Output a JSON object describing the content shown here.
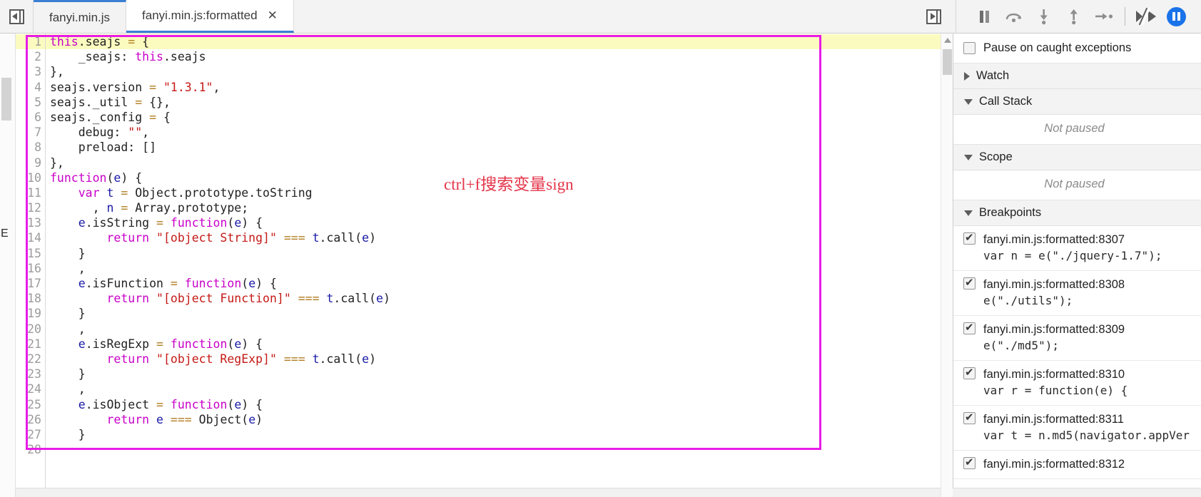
{
  "topbar": {
    "nav_back_icon": "panel-collapse-left-icon",
    "panel_toggle_icon": "panel-expand-right-icon",
    "tabs": [
      {
        "label": "fanyi.min.js",
        "active": false,
        "closable": false
      },
      {
        "label": "fanyi.min.js:formatted",
        "active": true,
        "closable": true,
        "close_label": "✕"
      }
    ],
    "debug_buttons": [
      {
        "name": "resume-pause-button",
        "icon": "pause-icon",
        "title": "Pause script execution"
      },
      {
        "name": "step-over-button",
        "icon": "step-over-icon",
        "title": "Step over next function call"
      },
      {
        "name": "step-into-button",
        "icon": "step-into-icon",
        "title": "Step into next function call"
      },
      {
        "name": "step-out-button",
        "icon": "step-out-icon",
        "title": "Step out of current function"
      },
      {
        "name": "step-button",
        "icon": "step-icon",
        "title": "Step"
      },
      {
        "name": "deactivate-breakpoints-button",
        "icon": "deactivate-breakpoints-icon",
        "title": "Deactivate breakpoints"
      },
      {
        "name": "pause-on-exceptions-button",
        "icon": "pause-on-exceptions-icon",
        "title": "Pause on exceptions"
      }
    ]
  },
  "editor": {
    "rail_letter": "E",
    "highlight_line": 1,
    "annotation": {
      "text": "ctrl+f搜索变量sign",
      "box_color": "#e81ce8",
      "text_color": "#e4354a"
    },
    "lines": [
      {
        "n": "1",
        "html": "<span class=\"k\">this</span><span class=\"pl\">.seajs </span><span class=\"op\">=</span><span class=\"pl\"> {</span>"
      },
      {
        "n": "2",
        "html": "<span class=\"pl\">    _seajs: </span><span class=\"k\">this</span><span class=\"pl\">.seajs</span>"
      },
      {
        "n": "3",
        "html": "<span class=\"pl\">},</span>"
      },
      {
        "n": "4",
        "html": "<span class=\"pl\">seajs.version </span><span class=\"op\">=</span><span class=\"pl\"> </span><span class=\"str\">\"1.3.1\"</span><span class=\"pl\">,</span>"
      },
      {
        "n": "5",
        "html": "<span class=\"pl\">seajs._util </span><span class=\"op\">=</span><span class=\"pl\"> {},</span>"
      },
      {
        "n": "6",
        "html": "<span class=\"pl\">seajs._config </span><span class=\"op\">=</span><span class=\"pl\"> {</span>"
      },
      {
        "n": "7",
        "html": "<span class=\"pl\">    debug: </span><span class=\"str\">\"\"</span><span class=\"pl\">,</span>"
      },
      {
        "n": "8",
        "html": "<span class=\"pl\">    preload: []</span>"
      },
      {
        "n": "9",
        "html": "<span class=\"pl\">},</span>"
      },
      {
        "n": "10",
        "html": "<span class=\"k\">function</span><span class=\"pl\">(</span><span class=\"vr\">e</span><span class=\"pl\">) {</span>"
      },
      {
        "n": "11",
        "html": "<span class=\"pl\">    </span><span class=\"k\">var</span><span class=\"pl\"> </span><span class=\"vr\">t</span><span class=\"pl\"> </span><span class=\"op\">=</span><span class=\"pl\"> Object.prototype.toString</span>"
      },
      {
        "n": "12",
        "html": "<span class=\"pl\">      , </span><span class=\"vr\">n</span><span class=\"pl\"> </span><span class=\"op\">=</span><span class=\"pl\"> Array.prototype;</span>"
      },
      {
        "n": "13",
        "html": "<span class=\"pl\">    </span><span class=\"vr\">e</span><span class=\"pl\">.isString </span><span class=\"op\">=</span><span class=\"pl\"> </span><span class=\"k\">function</span><span class=\"pl\">(</span><span class=\"vr\">e</span><span class=\"pl\">) {</span>"
      },
      {
        "n": "14",
        "html": "<span class=\"pl\">        </span><span class=\"k\">return</span><span class=\"pl\"> </span><span class=\"str\">\"[object String]\"</span><span class=\"pl\"> </span><span class=\"op\">===</span><span class=\"pl\"> </span><span class=\"vr\">t</span><span class=\"pl\">.call(</span><span class=\"vr\">e</span><span class=\"pl\">)</span>"
      },
      {
        "n": "15",
        "html": "<span class=\"pl\">    }</span>"
      },
      {
        "n": "16",
        "html": "<span class=\"pl\">    ,</span>"
      },
      {
        "n": "17",
        "html": "<span class=\"pl\">    </span><span class=\"vr\">e</span><span class=\"pl\">.isFunction </span><span class=\"op\">=</span><span class=\"pl\"> </span><span class=\"k\">function</span><span class=\"pl\">(</span><span class=\"vr\">e</span><span class=\"pl\">) {</span>"
      },
      {
        "n": "18",
        "html": "<span class=\"pl\">        </span><span class=\"k\">return</span><span class=\"pl\"> </span><span class=\"str\">\"[object Function]\"</span><span class=\"pl\"> </span><span class=\"op\">===</span><span class=\"pl\"> </span><span class=\"vr\">t</span><span class=\"pl\">.call(</span><span class=\"vr\">e</span><span class=\"pl\">)</span>"
      },
      {
        "n": "19",
        "html": "<span class=\"pl\">    }</span>"
      },
      {
        "n": "20",
        "html": "<span class=\"pl\">    ,</span>"
      },
      {
        "n": "21",
        "html": "<span class=\"pl\">    </span><span class=\"vr\">e</span><span class=\"pl\">.isRegExp </span><span class=\"op\">=</span><span class=\"pl\"> </span><span class=\"k\">function</span><span class=\"pl\">(</span><span class=\"vr\">e</span><span class=\"pl\">) {</span>"
      },
      {
        "n": "22",
        "html": "<span class=\"pl\">        </span><span class=\"k\">return</span><span class=\"pl\"> </span><span class=\"str\">\"[object RegExp]\"</span><span class=\"pl\"> </span><span class=\"op\">===</span><span class=\"pl\"> </span><span class=\"vr\">t</span><span class=\"pl\">.call(</span><span class=\"vr\">e</span><span class=\"pl\">)</span>"
      },
      {
        "n": "23",
        "html": "<span class=\"pl\">    }</span>"
      },
      {
        "n": "24",
        "html": "<span class=\"pl\">    ,</span>"
      },
      {
        "n": "25",
        "html": "<span class=\"pl\">    </span><span class=\"vr\">e</span><span class=\"pl\">.isObject </span><span class=\"op\">=</span><span class=\"pl\"> </span><span class=\"k\">function</span><span class=\"pl\">(</span><span class=\"vr\">e</span><span class=\"pl\">) {</span>"
      },
      {
        "n": "26",
        "html": "<span class=\"pl\">        </span><span class=\"k\">return</span><span class=\"pl\"> </span><span class=\"vr\">e</span><span class=\"pl\"> </span><span class=\"op\">===</span><span class=\"pl\"> Object(</span><span class=\"vr\">e</span><span class=\"pl\">)</span>"
      },
      {
        "n": "27",
        "html": "<span class=\"pl\">    }</span>"
      },
      {
        "n": "28",
        "html": "<span class=\"pl\"></span>"
      }
    ]
  },
  "sidebar": {
    "pause_on_caught": {
      "label": "Pause on caught exceptions",
      "checked": false
    },
    "sections": [
      {
        "name": "watch",
        "label": "Watch",
        "expanded": false
      },
      {
        "name": "call-stack",
        "label": "Call Stack",
        "expanded": true,
        "empty_text": "Not paused"
      },
      {
        "name": "scope",
        "label": "Scope",
        "expanded": true,
        "empty_text": "Not paused"
      },
      {
        "name": "breakpoints",
        "label": "Breakpoints",
        "expanded": true
      }
    ],
    "breakpoints": [
      {
        "location": "fanyi.min.js:formatted:8307",
        "snippet": "var n = e(\"./jquery-1.7\");",
        "checked": true
      },
      {
        "location": "fanyi.min.js:formatted:8308",
        "snippet": "e(\"./utils\");",
        "checked": true
      },
      {
        "location": "fanyi.min.js:formatted:8309",
        "snippet": "e(\"./md5\");",
        "checked": true
      },
      {
        "location": "fanyi.min.js:formatted:8310",
        "snippet": "var r = function(e) {",
        "checked": true
      },
      {
        "location": "fanyi.min.js:formatted:8311",
        "snippet": "var t = n.md5(navigator.appVer",
        "checked": true
      },
      {
        "location": "fanyi.min.js:formatted:8312",
        "snippet": "",
        "checked": true
      }
    ]
  }
}
